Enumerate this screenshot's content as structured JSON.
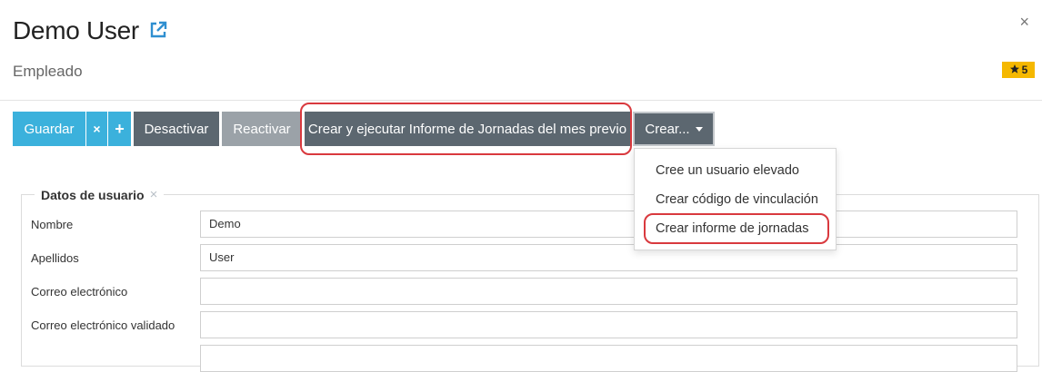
{
  "header": {
    "title": "Demo User",
    "external_link_icon": "external-link-icon",
    "close_label": "×",
    "subtitle": "Empleado",
    "badge": {
      "icon": "star-icon",
      "value": "5",
      "color": "#f5b800"
    }
  },
  "toolbar": {
    "guardar_label": "Guardar",
    "discard_label": "×",
    "add_label": "+",
    "desactivar_label": "Desactivar",
    "reactivar_label": "Reactivar",
    "informe_label": "Crear y ejecutar Informe de Jornadas del mes previo",
    "crear_label": "Crear...",
    "colors": {
      "primary": "#3bb1dc",
      "secondary": "#5c6770",
      "disabled": "#9ba2a8",
      "highlight": "#d9393e"
    }
  },
  "crear_menu": {
    "items": [
      {
        "label": "Cree un usuario elevado"
      },
      {
        "label": "Crear código de vinculación"
      },
      {
        "label": "Crear informe de jornadas",
        "highlighted": true
      }
    ]
  },
  "user_section": {
    "legend": "Datos de usuario",
    "legend_close": "×",
    "fields": [
      {
        "label": "Nombre",
        "value": "Demo"
      },
      {
        "label": "Apellidos",
        "value": "User"
      },
      {
        "label": "Correo electrónico",
        "value": ""
      },
      {
        "label": "Correo electrónico validado",
        "value": ""
      }
    ]
  }
}
